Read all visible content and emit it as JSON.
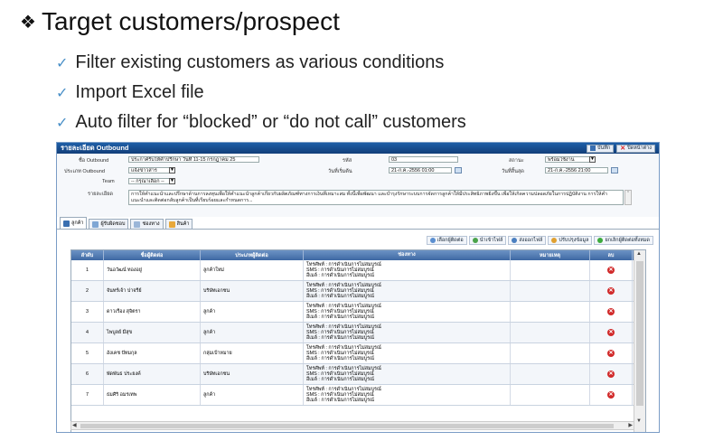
{
  "slide": {
    "title": "Target customers/prospect",
    "bullets": [
      "Filter existing customers as various conditions",
      "Import Excel file",
      "Auto filter for “blocked” or “do not call” customers"
    ]
  },
  "window": {
    "title": "รายละเอียด Outbound",
    "save_label": "บันทึก",
    "cancel_label": "ปิดหน้าต่าง"
  },
  "form": {
    "outbound_name_label": "ชื่อ Outbound",
    "outbound_name_value": "ประกาศรับให้คำปรึกษา วันที่ 11-15 กรกฎาคม 25",
    "code_label": "รหัส",
    "code_value": "03",
    "status_label": "สถานะ",
    "status_value": "พร้อมใช้งาน",
    "type_label": "ประเภท Outbound",
    "type_value": "แจ้งข่าวสาร",
    "start_label": "วันที่เริ่มต้น",
    "start_value": "21-ก.ค.-2556 01:00",
    "end_label": "วันที่สิ้นสุด",
    "end_value": "21-ก.ค.-2556 21:00",
    "team_label": "Team",
    "team_value": "-- กรุณาเลือก --",
    "detail_label": "รายละเอียด",
    "detail_value": "การให้คำแนะนำและปรึกษาด้านการลงทุนเพื่อให้คำแนะนำลูกค้าเกี่ยวกับผลิตภัณฑ์ทางการเงินที่เหมาะสม ทั้งนี้เพื่อพัฒนา และบำรุงรักษาระบบการจัดการลูกค้าให้มีประสิทธิภาพยิ่งขึ้น เพื่อให้เกิดความปลอดภัยในการปฏิบัติงาน การให้คำแนะนำและติดต่อกลับลูกค้าเป็นที่เรียบร้อยและกำหนดการ..."
  },
  "tabs": [
    "ลูกค้า",
    "ผู้รับผิดชอบ",
    "ช่องทาง",
    "สินค้า"
  ],
  "toolbar": [
    "เลือกผู้ติดต่อ",
    "นำเข้าไฟล์",
    "ส่งออกไฟล์",
    "ปรับปรุงข้อมูล",
    "ยกเลิกผู้ติดต่อทั้งหมด"
  ],
  "grid": {
    "headers": [
      "ลำดับ",
      "ชื่อผู้ติดต่อ",
      "ประเภทผู้ติดต่อ",
      "ช่องทาง",
      "หมายเหตุ",
      "ลบ"
    ],
    "channel_lines": [
      "โทรศัพท์ : การดำเนินการไม่สมบูรณ์",
      "SMS : การดำเนินการไม่สมบูรณ์",
      "อีเมล์ : การดำเนินการไม่สมบูรณ์"
    ],
    "rows": [
      {
        "no": "1",
        "name": "วันอวัฒน์ ทองอยู่",
        "type": "ลูกค้าใหม่"
      },
      {
        "no": "2",
        "name": "จันทร์เจ้า ปาจรีย์",
        "type": "บริษัทเอกชน"
      },
      {
        "no": "3",
        "name": "ดาวเรือง สุจิตรา",
        "type": "ลูกค้า"
      },
      {
        "no": "4",
        "name": "ไพบูลย์ มีสุข",
        "type": "ลูกค้า"
      },
      {
        "no": "5",
        "name": "อังเคช ปัทมกุล",
        "type": "กลุ่มเป้าหมาย"
      },
      {
        "no": "6",
        "name": "พัดพันธ ประยงค์",
        "type": "บริษัทเอกชน"
      },
      {
        "no": "7",
        "name": "ธมศิริ อมรเทพ",
        "type": "ลูกค้า"
      }
    ]
  }
}
